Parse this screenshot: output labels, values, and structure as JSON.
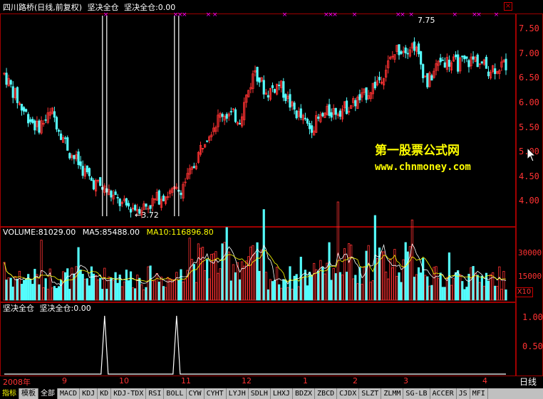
{
  "header": {
    "security": "四川路桥(日线,前复权)",
    "indicator_name": "坚决全仓",
    "indicator_value_label": "坚决全仓:0.00"
  },
  "close_button": "×",
  "price_axis": [
    "7.50",
    "7.00",
    "6.50",
    "6.00",
    "5.50",
    "5.00",
    "4.50",
    "4.00"
  ],
  "price_annotations": {
    "high": "7.75",
    "low": "←3.72"
  },
  "volume_header": {
    "volume": "VOLUME:81029.00",
    "ma5": "MA5:85488.00",
    "ma10": "MA10:116896.80"
  },
  "volume_axis": [
    "30000",
    "15000"
  ],
  "volume_unit": "X10",
  "indicator_header": {
    "title": "坚决全仓",
    "value": "坚决全仓:0.00"
  },
  "indicator_axis": [
    "1.00",
    "0.50"
  ],
  "time_axis": [
    "2008年",
    "9",
    "10",
    "11",
    "12",
    "1",
    "2",
    "3",
    "4"
  ],
  "period": "日线",
  "watermark": {
    "title": "第一股票公式网",
    "url": "www.chnmoney.com"
  },
  "tabs": [
    "指标",
    "模板",
    "全部",
    "MACD",
    "KDJ",
    "KD",
    "KDJ-TDX",
    "RSI",
    "BOLL",
    "CYW",
    "CYHT",
    "LYJH",
    "SDLH",
    "LHXJ",
    "BDZX",
    "ZBCD",
    "CJDX",
    "SLZT",
    "ZLMM",
    "SG-LB",
    "ACCER",
    "JS",
    "MFI"
  ],
  "colors": {
    "up": "#ff3232",
    "down": "#54fcfc",
    "ma5": "#ffffff",
    "ma10": "#ffff00",
    "mark": "#ff00ff",
    "frame": "#a00000"
  },
  "chart_data": {
    "type": "candlestick",
    "ylim": [
      3.6,
      7.9
    ],
    "high_value": 7.75,
    "low_value": 3.72,
    "signal_days": [
      46,
      79
    ]
  }
}
